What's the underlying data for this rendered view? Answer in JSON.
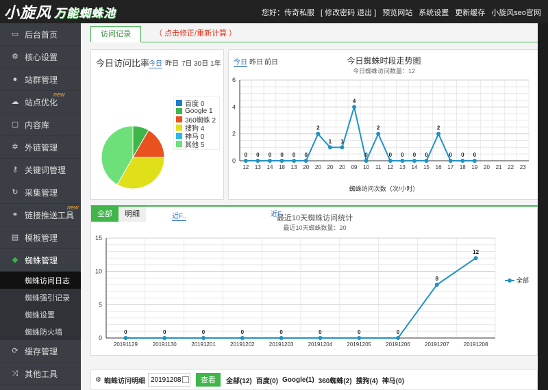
{
  "header": {
    "logo_main": "小旋风",
    "logo_sub": "万能蜘蛛池",
    "greeting": "您好：传奇私服",
    "change_pwd": "[ 修改密码 退出 ]",
    "preview": "预览网站",
    "settings": "系统设置",
    "update_cache": "更新缓存",
    "official": "小旋风seo官网"
  },
  "sidebar": {
    "items": [
      {
        "label": "后台首页",
        "icon": "monitor-icon"
      },
      {
        "label": "核心设置",
        "icon": "gear-icon"
      },
      {
        "label": "站群管理",
        "icon": "user-icon"
      },
      {
        "label": "站点优化",
        "icon": "cloud-icon",
        "badge": "new"
      },
      {
        "label": "内容库",
        "icon": "folder-icon"
      },
      {
        "label": "外链管理",
        "icon": "settings-icon"
      },
      {
        "label": "关键词管理",
        "icon": "key-icon"
      },
      {
        "label": "采集管理",
        "icon": "refresh-icon"
      },
      {
        "label": "链接推送工具",
        "icon": "link-icon",
        "badge": "new"
      },
      {
        "label": "模板管理",
        "icon": "template-icon"
      },
      {
        "label": "蜘蛛管理",
        "icon": "spider-icon"
      }
    ],
    "sub_items": [
      "蜘蛛访问日志",
      "蜘蛛强引记录",
      "蜘蛛设置",
      "蜘蛛防火墙"
    ],
    "bottom_items": [
      {
        "label": "缓存管理",
        "icon": "cache-icon"
      },
      {
        "label": "其他工具",
        "icon": "tools-icon"
      }
    ]
  },
  "tabs": {
    "visits": "访问记录",
    "fix": "（ 点击修正/重新计算 ）"
  },
  "pie_panel": {
    "title": "今日访问比率",
    "ranges": [
      "今日",
      "昨日",
      "7日",
      "30日",
      "1年"
    ],
    "legend": [
      {
        "label": "百度 0",
        "color": "#1e7ec8"
      },
      {
        "label": "Google 1",
        "color": "#3fb54a"
      },
      {
        "label": "360蜘蛛 2",
        "color": "#e8521e"
      },
      {
        "label": "搜狗 4",
        "color": "#dfe01a"
      },
      {
        "label": "神马 0",
        "color": "#2bb8e6"
      },
      {
        "label": "其他 5",
        "color": "#6ee07a"
      }
    ]
  },
  "hour_panel": {
    "ranges": [
      "今日",
      "昨日",
      "前日"
    ],
    "title": "今日蜘蛛时段走势图",
    "subtitle": "今日蜘蛛访问数量：12",
    "xlabel": "蜘蛛访问次数（次/小时）"
  },
  "daily_panel": {
    "btn_all": "全部",
    "btn_detail": "明细",
    "link1": "近F..",
    "link2": "近F..",
    "title": "最近10天蜘蛛访问统计",
    "subtitle": "最近10天蜘蛛数量：20",
    "legend": "全部"
  },
  "bottom_bar": {
    "label": "蜘蛛访问明细",
    "date_value": "20191208",
    "search_label": "查看",
    "filters": [
      "全部(12)",
      "百度(0)",
      "Google(1)",
      "360蜘蛛(2)",
      "搜狗(4)",
      "神马(0)"
    ]
  },
  "chart_data": [
    {
      "type": "pie",
      "title": "",
      "labels": [
        "百度",
        "Google",
        "360蜘蛛",
        "搜狗",
        "神马",
        "其他"
      ],
      "values": [
        0,
        1,
        2,
        4,
        0,
        5
      ],
      "colors": [
        "#1e7ec8",
        "#3fb54a",
        "#e8521e",
        "#dfe01a",
        "#2bb8e6",
        "#6ee07a"
      ]
    },
    {
      "type": "line",
      "title": "今日蜘蛛时段走势图",
      "xlabel": "蜘蛛访问次数（次/小时）",
      "categories": [
        "12",
        "13",
        "14",
        "18",
        "13",
        "20",
        "20",
        "20",
        "20",
        "09",
        "10",
        "11",
        "12",
        "13",
        "14",
        "15",
        "16",
        "17",
        "18",
        "19",
        "20",
        "21",
        "22",
        "23"
      ],
      "values": [
        0,
        0,
        0,
        0,
        0,
        0,
        2,
        1,
        1,
        4,
        0,
        2,
        0,
        0,
        0,
        0,
        2,
        0,
        0,
        0,
        null,
        null,
        null,
        null
      ],
      "ylim": [
        0,
        6
      ],
      "yticks": [
        0,
        2,
        4,
        6
      ],
      "grid": true
    },
    {
      "type": "line",
      "title": "最近10天蜘蛛访问统计",
      "categories": [
        "20191129",
        "20191130",
        "20191201",
        "20191202",
        "20191203",
        "20191204",
        "20191205",
        "20191206",
        "20191207",
        "20191208"
      ],
      "series": [
        {
          "name": "全部",
          "values": [
            0,
            0,
            0,
            0,
            0,
            0,
            0,
            0,
            8,
            12
          ]
        }
      ],
      "ylim": [
        0,
        15
      ],
      "yticks": [
        0,
        5,
        10,
        15
      ],
      "grid": true,
      "legend": "right"
    }
  ]
}
